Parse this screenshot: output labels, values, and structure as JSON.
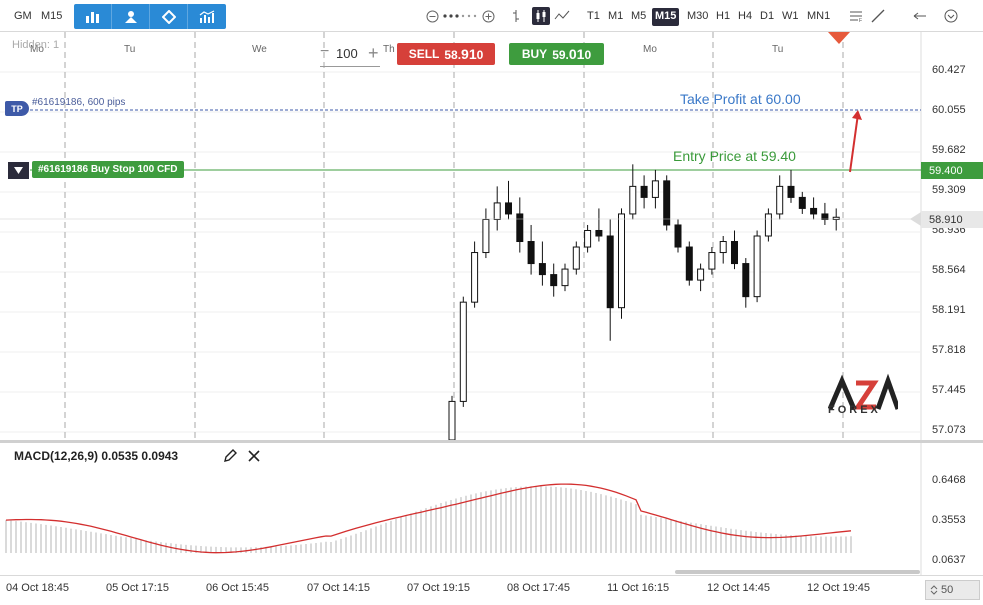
{
  "toolbar": {
    "account": "GM",
    "timeframe_short": "M15",
    "timeframes": [
      "T1",
      "M1",
      "M5",
      "M15",
      "M30",
      "H1",
      "H4",
      "D1",
      "W1",
      "MN1"
    ],
    "active_timeframe": "M15",
    "icons": [
      "bar-chart-icon",
      "trader-icon",
      "diamond-icon",
      "indicators-icon"
    ]
  },
  "trade_panel": {
    "hidden_label": "Hidden: 1",
    "quantity": "100",
    "sell_label": "SELL",
    "sell_price_main": "58.",
    "sell_price_big": "91",
    "sell_price_tail": "0",
    "buy_label": "BUY",
    "buy_price_main": "59.",
    "buy_price_big": "01",
    "buy_price_tail": "0"
  },
  "orders": {
    "tp_badge": "TP",
    "tp_text": "#61619186, 600 pips",
    "order_text": "#61619186 Buy Stop 100 CFD",
    "tp_annotation": "Take Profit at 60.00",
    "entry_annotation": "Entry Price at 59.40"
  },
  "price_axis": {
    "labels": [
      "60.427",
      "60.055",
      "59.682",
      "59.309",
      "58.936",
      "58.564",
      "58.191",
      "57.818",
      "57.445",
      "57.073"
    ],
    "entry_tag": "59.400",
    "current_tag": "58.910"
  },
  "day_labels": [
    "Mo",
    "Tu",
    "We",
    "Th",
    "Mo",
    "Tu"
  ],
  "macd": {
    "title": "MACD(12,26,9) 0.0535 0.0943",
    "axis_labels": [
      "0.6468",
      "0.3553",
      "0.0637"
    ]
  },
  "time_axis": {
    "labels": [
      "04 Oct 18:45",
      "05 Oct 17:15",
      "06 Oct 15:45",
      "07 Oct 14:15",
      "07 Oct 19:15",
      "08 Oct 17:45",
      "11 Oct 16:15",
      "12 Oct 14:45",
      "12 Oct 19:45"
    ],
    "zoom": "50"
  },
  "logo": {
    "text": "FOREX"
  },
  "colors": {
    "accent": "#2a8ad6",
    "sell": "#d6403a",
    "buy": "#3e9c3e",
    "tp_line": "#3e5aa8",
    "macd_signal": "#d32f2f"
  },
  "chart_data": {
    "type": "candlestick",
    "price_range": [
      56.9,
      60.6
    ],
    "candles": [
      [
        56.9,
        57.3,
        56.85,
        57.25
      ],
      [
        57.25,
        58.2,
        57.2,
        58.15
      ],
      [
        58.15,
        58.7,
        58.1,
        58.6
      ],
      [
        58.6,
        59.0,
        58.55,
        58.9
      ],
      [
        58.9,
        59.2,
        58.8,
        59.05
      ],
      [
        59.05,
        59.25,
        58.9,
        58.95
      ],
      [
        58.95,
        59.1,
        58.6,
        58.7
      ],
      [
        58.7,
        58.85,
        58.4,
        58.5
      ],
      [
        58.5,
        58.7,
        58.3,
        58.4
      ],
      [
        58.4,
        58.5,
        58.2,
        58.3
      ],
      [
        58.3,
        58.5,
        58.25,
        58.45
      ],
      [
        58.45,
        58.7,
        58.4,
        58.65
      ],
      [
        58.65,
        58.85,
        58.6,
        58.8
      ],
      [
        58.8,
        59.0,
        58.7,
        58.75
      ],
      [
        58.75,
        58.9,
        57.8,
        58.1
      ],
      [
        58.1,
        59.0,
        58.0,
        58.95
      ],
      [
        58.95,
        59.4,
        58.9,
        59.2
      ],
      [
        59.2,
        59.3,
        59.0,
        59.1
      ],
      [
        59.1,
        59.35,
        59.0,
        59.25
      ],
      [
        59.25,
        59.3,
        58.8,
        58.85
      ],
      [
        58.85,
        58.9,
        58.6,
        58.65
      ],
      [
        58.65,
        58.7,
        58.3,
        58.35
      ],
      [
        58.35,
        58.5,
        58.25,
        58.45
      ],
      [
        58.45,
        58.65,
        58.4,
        58.6
      ],
      [
        58.6,
        58.75,
        58.5,
        58.7
      ],
      [
        58.7,
        58.8,
        58.45,
        58.5
      ],
      [
        58.5,
        58.55,
        58.1,
        58.2
      ],
      [
        58.2,
        58.8,
        58.15,
        58.75
      ],
      [
        58.75,
        59.0,
        58.7,
        58.95
      ],
      [
        58.95,
        59.3,
        58.9,
        59.2
      ],
      [
        59.2,
        59.35,
        59.05,
        59.1
      ],
      [
        59.1,
        59.15,
        58.95,
        59.0
      ],
      [
        59.0,
        59.1,
        58.9,
        58.95
      ],
      [
        58.95,
        59.05,
        58.85,
        58.9
      ],
      [
        58.9,
        59.0,
        58.8,
        58.92
      ]
    ]
  }
}
